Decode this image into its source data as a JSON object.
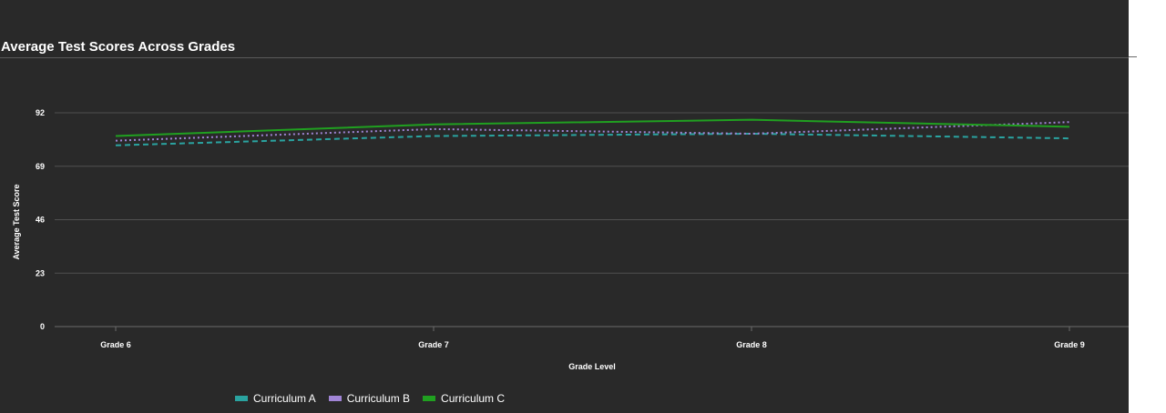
{
  "chart_data": {
    "type": "line",
    "title": "Average Test Scores Across Grades",
    "xlabel": "Grade Level",
    "ylabel": "Average Test Score",
    "categories": [
      "Grade 6",
      "Grade 7",
      "Grade 8",
      "Grade 9"
    ],
    "yticks": [
      0,
      23,
      46,
      69,
      92
    ],
    "ylim": [
      0,
      92
    ],
    "grid": true,
    "legend_position": "bottom",
    "series": [
      {
        "name": "Curriculum A",
        "values": [
          78,
          82,
          83,
          81
        ],
        "color": "#2aa3a0",
        "style": "dashed"
      },
      {
        "name": "Curriculum B",
        "values": [
          80,
          85,
          83,
          88
        ],
        "color": "#a185d6",
        "style": "dotted"
      },
      {
        "name": "Curriculum C",
        "values": [
          82,
          87,
          89,
          86
        ],
        "color": "#20a020",
        "style": "solid"
      }
    ]
  }
}
